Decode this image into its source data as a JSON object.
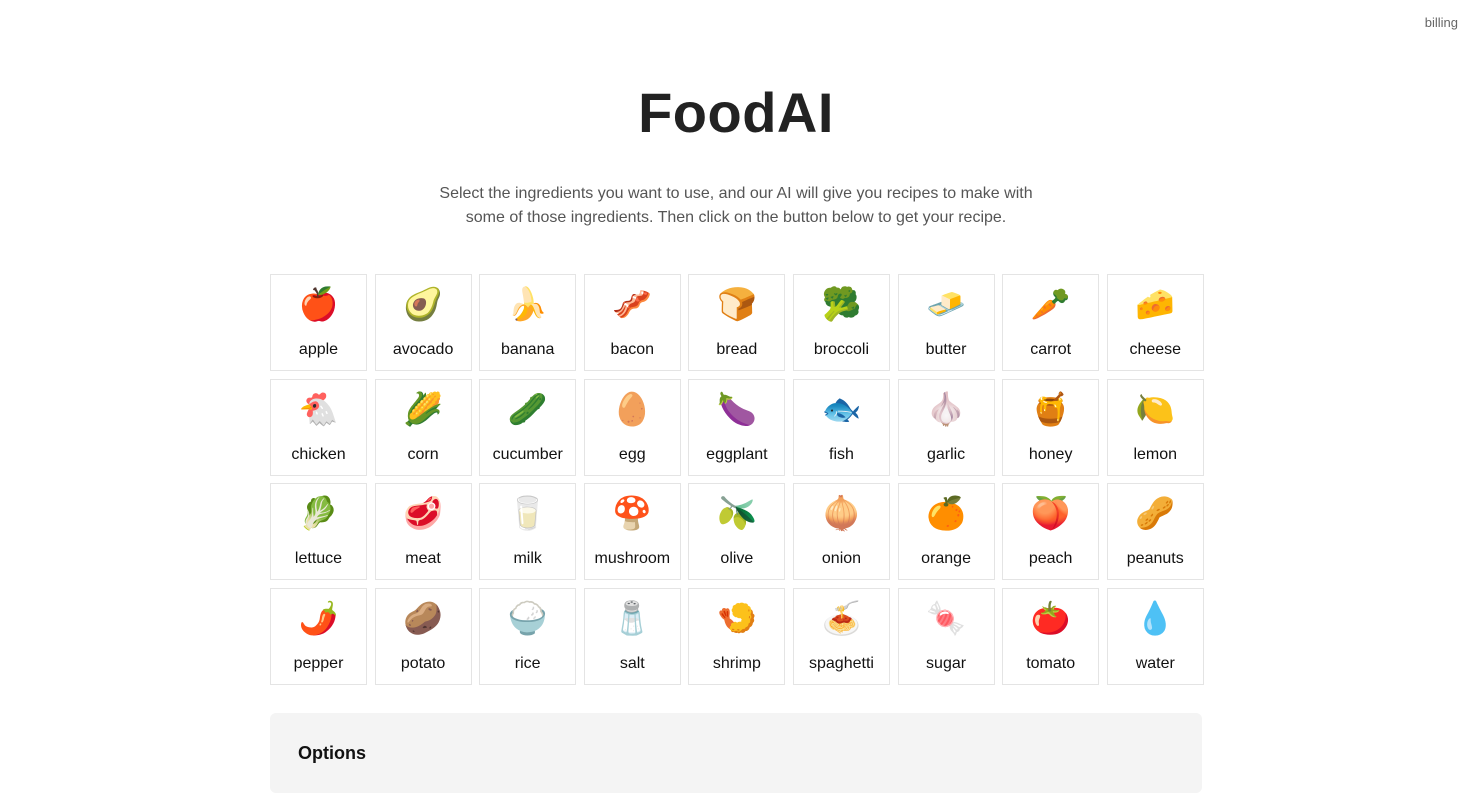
{
  "header": {
    "billing_link": "billing"
  },
  "hero": {
    "title": "FoodAI",
    "subtitle": "Select the ingredients you want to use, and our AI will give you recipes to make with some of those ingredients. Then click on the button below to get your recipe."
  },
  "ingredients": [
    {
      "label": "apple",
      "icon": "🍎"
    },
    {
      "label": "avocado",
      "icon": "🥑"
    },
    {
      "label": "banana",
      "icon": "🍌"
    },
    {
      "label": "bacon",
      "icon": "🥓"
    },
    {
      "label": "bread",
      "icon": "🍞"
    },
    {
      "label": "broccoli",
      "icon": "🥦"
    },
    {
      "label": "butter",
      "icon": "🧈"
    },
    {
      "label": "carrot",
      "icon": "🥕"
    },
    {
      "label": "cheese",
      "icon": "🧀"
    },
    {
      "label": "chicken",
      "icon": "🐔"
    },
    {
      "label": "corn",
      "icon": "🌽"
    },
    {
      "label": "cucumber",
      "icon": "🥒"
    },
    {
      "label": "egg",
      "icon": "🥚"
    },
    {
      "label": "eggplant",
      "icon": "🍆"
    },
    {
      "label": "fish",
      "icon": "🐟"
    },
    {
      "label": "garlic",
      "icon": "🧄"
    },
    {
      "label": "honey",
      "icon": "🍯"
    },
    {
      "label": "lemon",
      "icon": "🍋"
    },
    {
      "label": "lettuce",
      "icon": "🥬"
    },
    {
      "label": "meat",
      "icon": "🥩"
    },
    {
      "label": "milk",
      "icon": "🥛"
    },
    {
      "label": "mushroom",
      "icon": "🍄"
    },
    {
      "label": "olive",
      "icon": "🫒"
    },
    {
      "label": "onion",
      "icon": "🧅"
    },
    {
      "label": "orange",
      "icon": "🍊"
    },
    {
      "label": "peach",
      "icon": "🍑"
    },
    {
      "label": "peanuts",
      "icon": "🥜"
    },
    {
      "label": "pepper",
      "icon": "🌶️"
    },
    {
      "label": "potato",
      "icon": "🥔"
    },
    {
      "label": "rice",
      "icon": "🍚"
    },
    {
      "label": "salt",
      "icon": "🧂"
    },
    {
      "label": "shrimp",
      "icon": "🍤"
    },
    {
      "label": "spaghetti",
      "icon": "🍝"
    },
    {
      "label": "sugar",
      "icon": "🍬"
    },
    {
      "label": "tomato",
      "icon": "🍅"
    },
    {
      "label": "water",
      "icon": "💧"
    }
  ],
  "options": {
    "heading": "Options"
  }
}
